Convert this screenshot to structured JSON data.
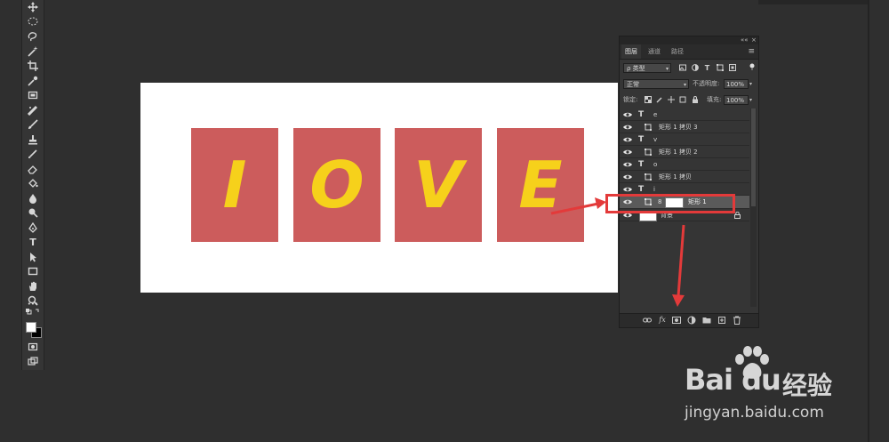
{
  "toolbar": {
    "tools": [
      "move-tool",
      "marquee-tool",
      "lasso-tool",
      "magic-wand-tool",
      "crop-tool",
      "eyedropper-tool",
      "frame-tool",
      "healing-brush-tool",
      "brush-tool",
      "clone-stamp-tool",
      "history-brush-tool",
      "eraser-tool",
      "paint-bucket-tool",
      "blur-tool",
      "dodge-tool",
      "pen-tool",
      "type-tool",
      "path-selection-tool",
      "rectangle-tool",
      "hand-tool",
      "zoom-tool",
      "more-tools"
    ],
    "type_tool_glyph": "T",
    "more_glyph": "•••",
    "foreground_color": "#ffffff",
    "background_color": "#000000"
  },
  "canvas": {
    "letters": [
      "I",
      "O",
      "V",
      "E"
    ],
    "box_color": "#cc5c5c",
    "letter_color": "#f6d11b"
  },
  "layers_panel": {
    "collapse_label": "««",
    "close_label": "×",
    "tabs": [
      "图层",
      "通道",
      "路径"
    ],
    "active_tab": 0,
    "menu_glyph": "≡",
    "filter_dropdown": "ρ 类型",
    "blend_mode": "正常",
    "opacity_label": "不透明度:",
    "opacity_value": "100%",
    "lock_label": "锁定:",
    "fill_label": "填充:",
    "fill_value": "100%",
    "filter_icons": [
      "image-filter-icon",
      "adjustment-filter-icon",
      "type-filter-icon",
      "shape-filter-icon",
      "smart-object-filter-icon"
    ],
    "lock_icons": [
      "lock-transparent-icon",
      "lock-pixels-icon",
      "lock-position-icon",
      "lock-artboard-icon",
      "lock-all-icon"
    ],
    "layers": [
      {
        "kind": "text",
        "name": "e"
      },
      {
        "kind": "shape",
        "name": "矩形 1 拷贝 3"
      },
      {
        "kind": "text",
        "name": "v"
      },
      {
        "kind": "shape",
        "name": "矩形 1 拷贝 2"
      },
      {
        "kind": "text",
        "name": "o"
      },
      {
        "kind": "shape",
        "name": "矩形 1 拷贝"
      },
      {
        "kind": "text",
        "name": "i"
      },
      {
        "kind": "shape-mask",
        "name": "矩形 1",
        "selected": true
      },
      {
        "kind": "background",
        "name": "背景"
      }
    ],
    "footer_icons": [
      "link-layers-icon",
      "fx-icon",
      "add-mask-icon",
      "adjustment-layer-icon",
      "new-group-icon",
      "new-layer-icon",
      "delete-layer-icon"
    ],
    "fx_label": "fx"
  },
  "annotation": {
    "color": "#e33a3a"
  },
  "watermark": {
    "brand": "Bai du",
    "cn": "经验",
    "url": "jingyan.baidu.com"
  }
}
